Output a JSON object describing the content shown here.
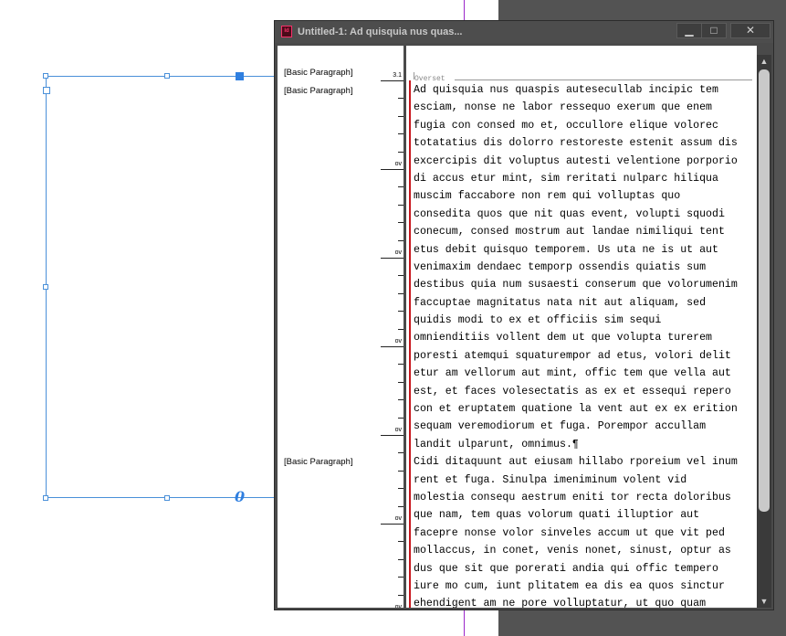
{
  "window": {
    "title": "Untitled-1: Ad quisquia nus quas...",
    "app_icon": "Id",
    "min_icon": "▁",
    "max_icon": "□",
    "close_icon": "✕"
  },
  "overset_label": "Overset",
  "overset_mark": "0",
  "paragraph_styles": [
    "[Basic Paragraph]",
    "[Basic Paragraph]",
    "[Basic Paragraph]"
  ],
  "depth_labels": [
    "3.1",
    "ov",
    "ov",
    "ov",
    "ov",
    "ov",
    "ov"
  ],
  "text_lines": [
    "Ad quisquia nus quaspis autesecullab incipic tem",
    "esciam, nonse ne labor ressequo exerum que enem",
    "fugia con consed mo et, occullore elique volorec",
    "totatatius dis dolorro restoreste estenit assum dis",
    "excercipis dit voluptus autesti velentione porporio",
    "di accus etur mint, sim reritati nulparc hiliqua",
    "muscim faccabore non rem qui volluptas quo",
    "consedita quos que nit quas event, volupti squodi",
    "conecum, consed mostrum aut landae nimiliqui tent",
    "etus debit quisquo temporem. Us uta ne is ut aut",
    "venimaxim dendaec temporp ossendis quiatis sum",
    "destibus quia num susaesti conserum que volorumenim",
    "faccuptae magnitatus nata nit aut aliquam, sed",
    "quidis modi to ex et officiis sim sequi",
    "omnienditiis vollent dem ut que volupta turerem",
    "poresti atemqui squaturempor ad etus, volori delit",
    "etur am vellorum aut mint, offic tem que vella aut",
    "est, et faces volesectatis as ex et essequi repero",
    "con et eruptatem quatione la vent aut ex ex erition",
    "sequam veremodiorum et fuga. Porempor accullam",
    "landit ulparunt, omnimus.¶",
    "Cidi ditaquunt aut eiusam hillabo rporeium vel inum",
    "rent et fuga. Sinulpa imeniminum volent vid",
    "molestia consequ aestrum eniti tor recta doloribus",
    "que nam, tem quas volorum quati illuptior aut",
    "facepre nonse volor sinveles accum ut que vit ped",
    "mollaccus, in conet, venis nonet, sinust, optur as",
    "dus que sit que porerati andia qui offic tempero",
    "iure mo cum, iunt plitatem ea dis ea quos sinctur",
    "ehendigent am ne pore volluptatur, ut quo quam"
  ],
  "scrollbar": {
    "up": "▲",
    "down": "▼"
  }
}
